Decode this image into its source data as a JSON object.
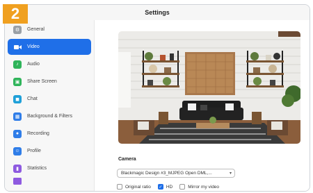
{
  "badge": "2",
  "window": {
    "title": "Settings"
  },
  "sidebar": {
    "items": [
      {
        "label": "General",
        "icon": "gear-icon",
        "color": "#9aa0a6",
        "active": false
      },
      {
        "label": "Video",
        "icon": "video-camera-icon",
        "color": "#ffffff",
        "active": true
      },
      {
        "label": "Audio",
        "icon": "headphones-icon",
        "color": "#2fb45a",
        "active": false
      },
      {
        "label": "Share Screen",
        "icon": "share-screen-icon",
        "color": "#2fb45a",
        "active": false
      },
      {
        "label": "Chat",
        "icon": "chat-icon",
        "color": "#1fa0d8",
        "active": false
      },
      {
        "label": "Background & Filters",
        "icon": "background-icon",
        "color": "#2f7de8",
        "active": false
      },
      {
        "label": "Recording",
        "icon": "recording-icon",
        "color": "#2f7de8",
        "active": false
      },
      {
        "label": "Profile",
        "icon": "profile-icon",
        "color": "#2f7de8",
        "active": false
      },
      {
        "label": "Statistics",
        "icon": "statistics-icon",
        "color": "#8e5ae0",
        "active": false
      }
    ]
  },
  "camera": {
    "label": "Camera",
    "selected": "Blackmagic Design #3_MJPEG Open DML,..."
  },
  "options": {
    "original_ratio": {
      "label": "Original ratio",
      "checked": false
    },
    "hd": {
      "label": "HD",
      "checked": true
    },
    "mirror": {
      "label": "Mirror my video",
      "checked": false
    }
  },
  "colors": {
    "accent": "#1f6fe8",
    "badge": "#f0a020"
  }
}
